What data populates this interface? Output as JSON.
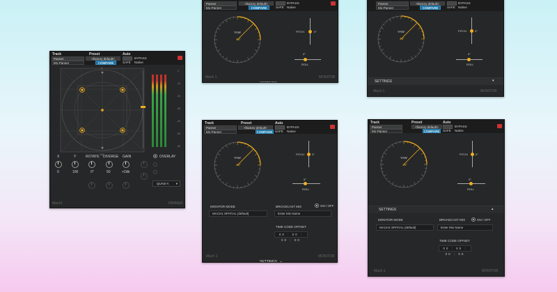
{
  "header": {
    "track_label": "Track",
    "preset_label": "Preset",
    "auto_label": "Auto",
    "track_name": "Panner",
    "track_sub": "M1-Panner",
    "preset_name": "<factory default>",
    "compare_label": "COMPARE",
    "bypass_label": "BYPASS",
    "safe_label": "SAFE",
    "native_label": "Native"
  },
  "panner": {
    "params": [
      "X",
      "Y",
      "ROTATE",
      "DIVERGE",
      "GAIN"
    ],
    "values": [
      "0",
      "100",
      "0°",
      "50",
      "+2db"
    ],
    "overlay_label": "OVERLAY",
    "mode_value": "QUAD-A",
    "footer_left": "Mach1",
    "footer_right": "PANNER",
    "meter_scale": [
      "0",
      "-10",
      "-20",
      "-30",
      "-40",
      "-50",
      "-60"
    ],
    "grid_top_label": "0",
    "grid_bottom_label": "180"
  },
  "monitor": {
    "yaw_label": "YAW",
    "yaw_value": "45°",
    "pitch_label": "PITCH",
    "pitch_value": "0°",
    "roll_label": "ROLL",
    "roll_value": "0°",
    "settings_label": "SETTINGS",
    "footer_left": "Mach 1",
    "footer_right": "MONITOR"
  },
  "settings": {
    "monitor_mode_label": "MONITOR MODE",
    "monitor_mode_value": "MACH1 SPATIAL (default)",
    "broadcast_mix_label": "BROADCAST MIX",
    "on_off_label": "ON / OFF",
    "mix_name_placeholder": "Enter Mix Name",
    "time_code_label": "TIME CODE OFFSET",
    "time_code_value": "00 : 00 : 00 : 00",
    "time_code_parts": [
      "00",
      "00",
      "00",
      "00"
    ]
  },
  "colors": {
    "accent": "#f0b020",
    "blue": "#1e6e9a",
    "panel": "#262728"
  }
}
